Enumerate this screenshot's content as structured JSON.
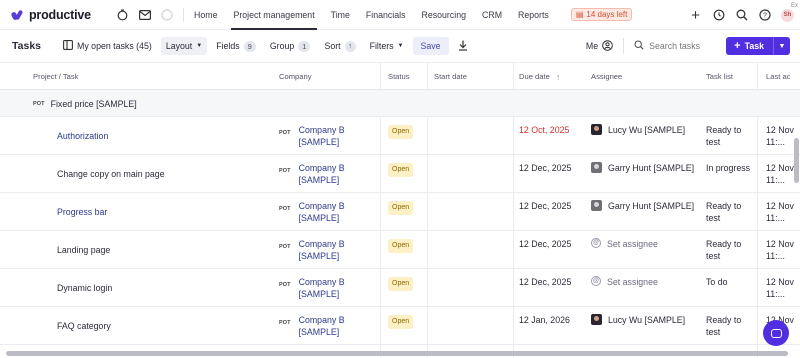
{
  "app": {
    "name": "productive"
  },
  "nav": {
    "links": [
      {
        "label": "Home",
        "active": false
      },
      {
        "label": "Project management",
        "active": true
      },
      {
        "label": "Time",
        "active": false
      },
      {
        "label": "Financials",
        "active": false
      },
      {
        "label": "Resourcing",
        "active": false
      },
      {
        "label": "CRM",
        "active": false
      },
      {
        "label": "Reports",
        "active": false
      }
    ],
    "trial_badge": "14 days left",
    "user_initials": "Sh",
    "ext_label": "Ex",
    "accent": "#5c3bdc"
  },
  "toolbar": {
    "title": "Tasks",
    "view_name": "My open tasks (45)",
    "layout_label": "Layout",
    "fields_label": "Fields",
    "fields_count": "9",
    "group_label": "Group",
    "group_count": "1",
    "sort_label": "Sort",
    "filters_label": "Filters",
    "save_label": "Save",
    "me_label": "Me",
    "search_placeholder": "Search tasks",
    "task_button_label": "Task",
    "task_button_color": "#4f2fe0"
  },
  "table": {
    "columns": [
      "Project / Task",
      "Company",
      "Status",
      "Start date",
      "Due date",
      "Assignee",
      "Task list",
      "Last ac"
    ],
    "group": {
      "tag": "POT",
      "label": "Fixed price [SAMPLE]"
    },
    "rows": [
      {
        "task": "Authorization",
        "company_tag": "POT",
        "company_line1": "Company B",
        "company_line2": "[SAMPLE]",
        "status": "Open",
        "start": "",
        "due": "12 Oct, 2025",
        "due_overdue": true,
        "assignee": "Lucy Wu [SAMPLE]",
        "assignee_kind": "avatar",
        "list_line1": "Ready to",
        "list_line2": "test",
        "last_line1": "12 Nov",
        "last_line2": "11:..."
      },
      {
        "task": "Change copy on main page",
        "company_tag": "POT",
        "company_line1": "Company B",
        "company_line2": "[SAMPLE]",
        "status": "Open",
        "start": "",
        "due": "12 Dec, 2025",
        "due_overdue": false,
        "assignee": "Garry Hunt [SAMPLE]",
        "assignee_kind": "avatar-grey",
        "list_line1": "In progress",
        "list_line2": "",
        "last_line1": "12 Nov",
        "last_line2": "11:..."
      },
      {
        "task": "Progress bar",
        "company_tag": "POT",
        "company_line1": "Company B",
        "company_line2": "[SAMPLE]",
        "status": "Open",
        "start": "",
        "due": "12 Dec, 2025",
        "due_overdue": false,
        "assignee": "Garry Hunt [SAMPLE]",
        "assignee_kind": "avatar-grey",
        "list_line1": "Ready to",
        "list_line2": "test",
        "last_line1": "12 Nov",
        "last_line2": "11:..."
      },
      {
        "task": "Landing page",
        "company_tag": "POT",
        "company_line1": "Company B",
        "company_line2": "[SAMPLE]",
        "status": "Open",
        "start": "",
        "due": "12 Dec, 2025",
        "due_overdue": false,
        "assignee": "Set assignee",
        "assignee_kind": "none",
        "list_line1": "Ready to",
        "list_line2": "test",
        "last_line1": "12 Nov",
        "last_line2": "11:..."
      },
      {
        "task": "Dynamic login",
        "company_tag": "POT",
        "company_line1": "Company B",
        "company_line2": "[SAMPLE]",
        "status": "Open",
        "start": "",
        "due": "12 Dec, 2025",
        "due_overdue": false,
        "assignee": "Set assignee",
        "assignee_kind": "none",
        "list_line1": "To do",
        "list_line2": "",
        "last_line1": "12 Nov",
        "last_line2": "11:..."
      },
      {
        "task": "FAQ category",
        "company_tag": "POT",
        "company_line1": "Company B",
        "company_line2": "[SAMPLE]",
        "status": "Open",
        "start": "",
        "due": "12 Jan, 2026",
        "due_overdue": false,
        "assignee": "Lucy Wu [SAMPLE]",
        "assignee_kind": "avatar",
        "list_line1": "Ready to",
        "list_line2": "test",
        "last_line1": "12 Nov",
        "last_line2": "11:..."
      }
    ]
  }
}
